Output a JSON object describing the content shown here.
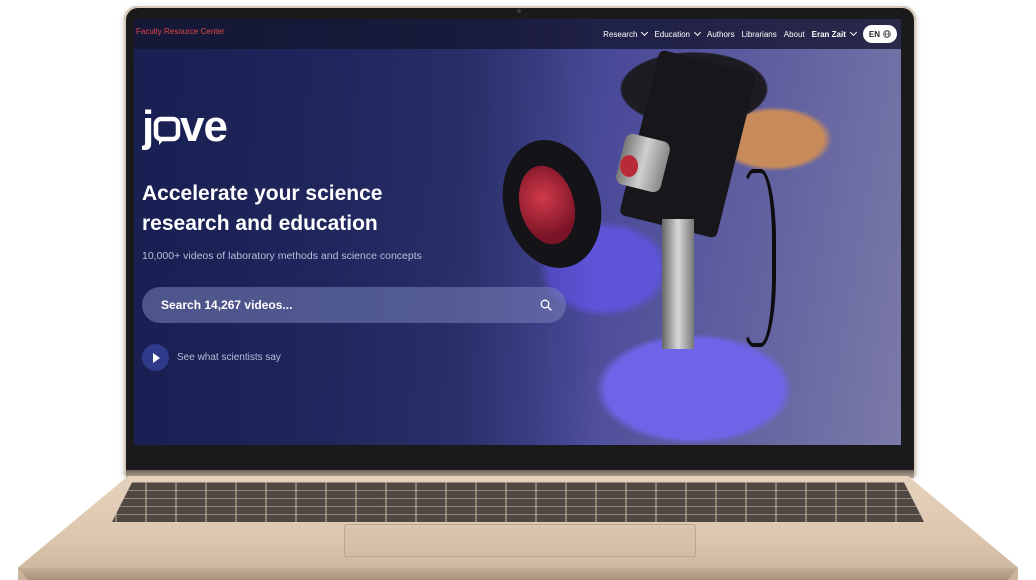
{
  "header": {
    "site_label": "Faculty Resource Center",
    "nav": [
      {
        "label": "Research",
        "dropdown": true
      },
      {
        "label": "Education",
        "dropdown": true
      },
      {
        "label": "Authors",
        "dropdown": false
      },
      {
        "label": "Librarians",
        "dropdown": false
      },
      {
        "label": "About",
        "dropdown": false
      }
    ],
    "user": "Eran Zait",
    "language": "EN",
    "language_icon": "globe-icon"
  },
  "hero": {
    "logo_text": "jove",
    "headline_line1": "Accelerate your science",
    "headline_line2": "research and education",
    "subheadline": "10,000+ videos of laboratory methods and science concepts",
    "search_placeholder": "Search 14,267 videos...",
    "search_icon": "search-icon",
    "cta_label": "See what scientists say",
    "cta_icon": "play-icon"
  },
  "colors": {
    "accent_red": "#e24848",
    "hero_navy": "#26306a",
    "play_button": "#2f3a8a"
  }
}
